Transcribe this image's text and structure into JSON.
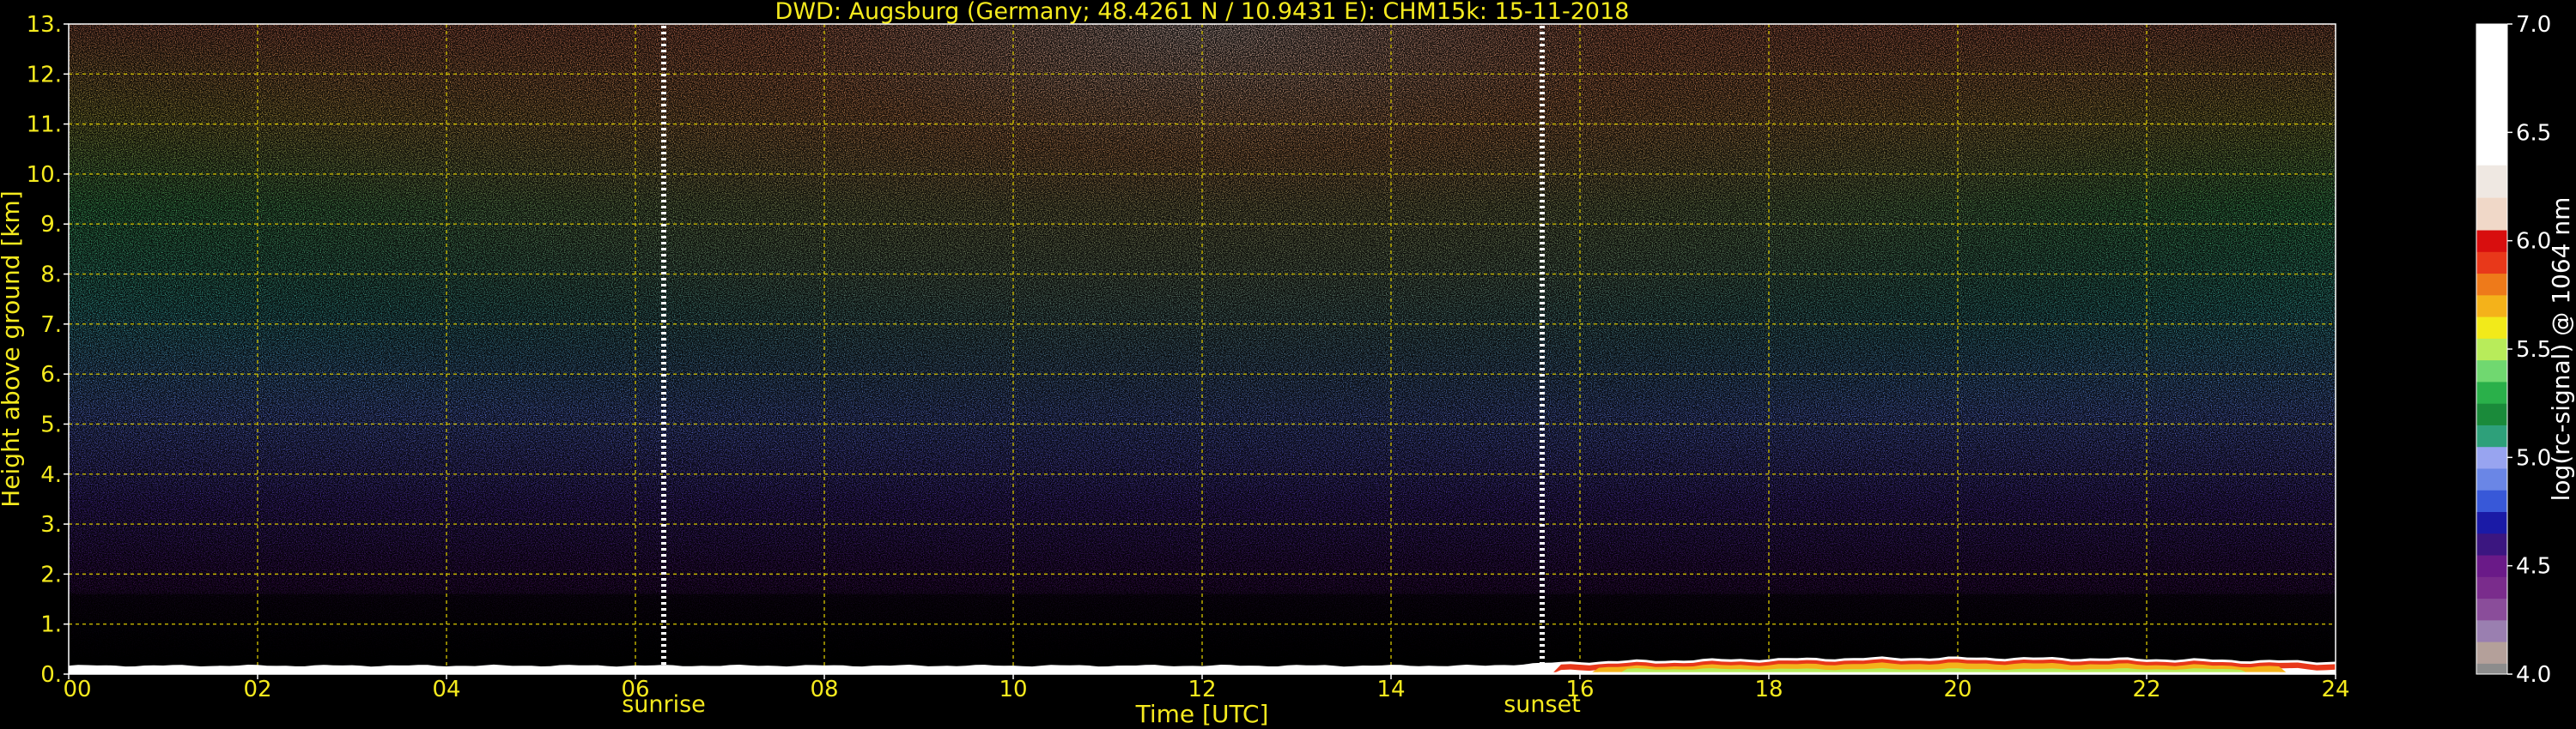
{
  "chart_data": {
    "type": "heatmap",
    "title": "DWD: Augsburg (Germany; 48.4261 N / 10.9431 E):    CHM15k: 15-11-2018",
    "xlabel": "Time [UTC]",
    "ylabel": "Height above ground [km]",
    "xlim": [
      0,
      24
    ],
    "ylim": [
      0,
      13
    ],
    "x_ticks": [
      0,
      2,
      4,
      6,
      8,
      10,
      12,
      14,
      16,
      18,
      20,
      22,
      24
    ],
    "x_tick_labels": [
      "00",
      "02",
      "04",
      "06",
      "08",
      "10",
      "12",
      "14",
      "16",
      "18",
      "20",
      "22",
      "24"
    ],
    "y_ticks": [
      0,
      1,
      2,
      3,
      4,
      5,
      6,
      7,
      8,
      9,
      10,
      11,
      12,
      13
    ],
    "y_tick_labels": [
      "0.",
      "1.",
      "2.",
      "3.",
      "4.",
      "5.",
      "6.",
      "7.",
      "8.",
      "9.",
      "10.",
      "11.",
      "12.",
      "13."
    ],
    "grid": true,
    "annotations": [
      {
        "text": "sunrise",
        "x": 6.3
      },
      {
        "text": "sunset",
        "x": 15.6
      }
    ],
    "colorbar": {
      "label": "log(rc-signal) @ 1064 nm",
      "range": [
        4.0,
        7.0
      ],
      "ticks": [
        4.0,
        4.5,
        5.0,
        5.5,
        6.0,
        6.5,
        7.0
      ],
      "tick_labels": [
        "4.0",
        "4.5",
        "5.0",
        "5.5",
        "6.0",
        "6.5",
        "7.0"
      ],
      "levels": [
        {
          "from": 4.0,
          "to": 4.05,
          "color": "#8c8c8c"
        },
        {
          "from": 4.05,
          "to": 4.15,
          "color": "#b4a09a"
        },
        {
          "from": 4.15,
          "to": 4.25,
          "color": "#9a7fb0"
        },
        {
          "from": 4.25,
          "to": 4.35,
          "color": "#8a4d9a"
        },
        {
          "from": 4.35,
          "to": 4.45,
          "color": "#7a2c8c"
        },
        {
          "from": 4.45,
          "to": 4.55,
          "color": "#6a1a88"
        },
        {
          "from": 4.55,
          "to": 4.65,
          "color": "#3b1680"
        },
        {
          "from": 4.65,
          "to": 4.75,
          "color": "#1a1aa6"
        },
        {
          "from": 4.75,
          "to": 4.85,
          "color": "#3858d8"
        },
        {
          "from": 4.85,
          "to": 4.95,
          "color": "#6a86e6"
        },
        {
          "from": 4.95,
          "to": 5.05,
          "color": "#98a4f0"
        },
        {
          "from": 5.05,
          "to": 5.15,
          "color": "#2ea07a"
        },
        {
          "from": 5.15,
          "to": 5.25,
          "color": "#1a8a3a"
        },
        {
          "from": 5.25,
          "to": 5.35,
          "color": "#2ab04a"
        },
        {
          "from": 5.35,
          "to": 5.45,
          "color": "#70d870"
        },
        {
          "from": 5.45,
          "to": 5.55,
          "color": "#b8ec5a"
        },
        {
          "from": 5.55,
          "to": 5.65,
          "color": "#f2ea1a"
        },
        {
          "from": 5.65,
          "to": 5.75,
          "color": "#f4b21a"
        },
        {
          "from": 5.75,
          "to": 5.85,
          "color": "#ee7a1a"
        },
        {
          "from": 5.85,
          "to": 5.95,
          "color": "#e8381a"
        },
        {
          "from": 5.95,
          "to": 6.05,
          "color": "#d80e0e"
        },
        {
          "from": 6.05,
          "to": 6.2,
          "color": "#f0d8c8"
        },
        {
          "from": 6.2,
          "to": 6.35,
          "color": "#efe8e2"
        },
        {
          "from": 6.35,
          "to": 7.0,
          "color": "#ffffff"
        }
      ]
    }
  }
}
